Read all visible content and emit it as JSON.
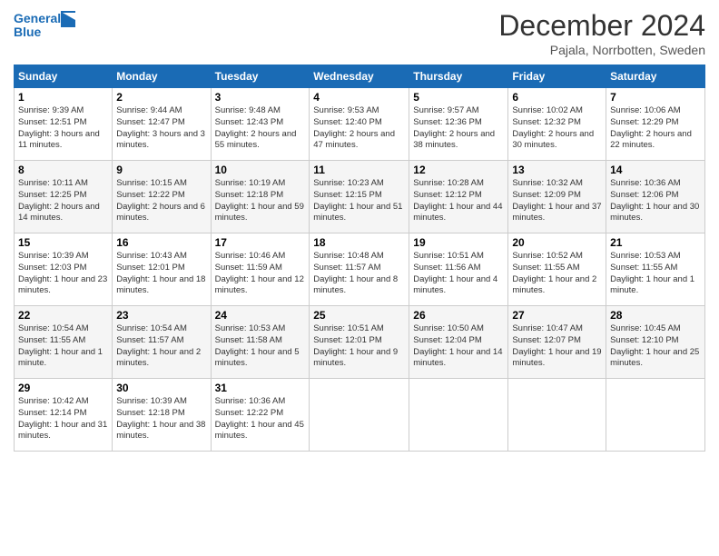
{
  "header": {
    "logo_text_line1": "General",
    "logo_text_line2": "Blue",
    "month_title": "December 2024",
    "location": "Pajala, Norrbotten, Sweden"
  },
  "days_of_week": [
    "Sunday",
    "Monday",
    "Tuesday",
    "Wednesday",
    "Thursday",
    "Friday",
    "Saturday"
  ],
  "weeks": [
    [
      {
        "num": "1",
        "info": "Sunrise: 9:39 AM\nSunset: 12:51 PM\nDaylight: 3 hours and 11 minutes."
      },
      {
        "num": "2",
        "info": "Sunrise: 9:44 AM\nSunset: 12:47 PM\nDaylight: 3 hours and 3 minutes."
      },
      {
        "num": "3",
        "info": "Sunrise: 9:48 AM\nSunset: 12:43 PM\nDaylight: 2 hours and 55 minutes."
      },
      {
        "num": "4",
        "info": "Sunrise: 9:53 AM\nSunset: 12:40 PM\nDaylight: 2 hours and 47 minutes."
      },
      {
        "num": "5",
        "info": "Sunrise: 9:57 AM\nSunset: 12:36 PM\nDaylight: 2 hours and 38 minutes."
      },
      {
        "num": "6",
        "info": "Sunrise: 10:02 AM\nSunset: 12:32 PM\nDaylight: 2 hours and 30 minutes."
      },
      {
        "num": "7",
        "info": "Sunrise: 10:06 AM\nSunset: 12:29 PM\nDaylight: 2 hours and 22 minutes."
      }
    ],
    [
      {
        "num": "8",
        "info": "Sunrise: 10:11 AM\nSunset: 12:25 PM\nDaylight: 2 hours and 14 minutes."
      },
      {
        "num": "9",
        "info": "Sunrise: 10:15 AM\nSunset: 12:22 PM\nDaylight: 2 hours and 6 minutes."
      },
      {
        "num": "10",
        "info": "Sunrise: 10:19 AM\nSunset: 12:18 PM\nDaylight: 1 hour and 59 minutes."
      },
      {
        "num": "11",
        "info": "Sunrise: 10:23 AM\nSunset: 12:15 PM\nDaylight: 1 hour and 51 minutes."
      },
      {
        "num": "12",
        "info": "Sunrise: 10:28 AM\nSunset: 12:12 PM\nDaylight: 1 hour and 44 minutes."
      },
      {
        "num": "13",
        "info": "Sunrise: 10:32 AM\nSunset: 12:09 PM\nDaylight: 1 hour and 37 minutes."
      },
      {
        "num": "14",
        "info": "Sunrise: 10:36 AM\nSunset: 12:06 PM\nDaylight: 1 hour and 30 minutes."
      }
    ],
    [
      {
        "num": "15",
        "info": "Sunrise: 10:39 AM\nSunset: 12:03 PM\nDaylight: 1 hour and 23 minutes."
      },
      {
        "num": "16",
        "info": "Sunrise: 10:43 AM\nSunset: 12:01 PM\nDaylight: 1 hour and 18 minutes."
      },
      {
        "num": "17",
        "info": "Sunrise: 10:46 AM\nSunset: 11:59 AM\nDaylight: 1 hour and 12 minutes."
      },
      {
        "num": "18",
        "info": "Sunrise: 10:48 AM\nSunset: 11:57 AM\nDaylight: 1 hour and 8 minutes."
      },
      {
        "num": "19",
        "info": "Sunrise: 10:51 AM\nSunset: 11:56 AM\nDaylight: 1 hour and 4 minutes."
      },
      {
        "num": "20",
        "info": "Sunrise: 10:52 AM\nSunset: 11:55 AM\nDaylight: 1 hour and 2 minutes."
      },
      {
        "num": "21",
        "info": "Sunrise: 10:53 AM\nSunset: 11:55 AM\nDaylight: 1 hour and 1 minute."
      }
    ],
    [
      {
        "num": "22",
        "info": "Sunrise: 10:54 AM\nSunset: 11:55 AM\nDaylight: 1 hour and 1 minute."
      },
      {
        "num": "23",
        "info": "Sunrise: 10:54 AM\nSunset: 11:57 AM\nDaylight: 1 hour and 2 minutes."
      },
      {
        "num": "24",
        "info": "Sunrise: 10:53 AM\nSunset: 11:58 AM\nDaylight: 1 hour and 5 minutes."
      },
      {
        "num": "25",
        "info": "Sunrise: 10:51 AM\nSunset: 12:01 PM\nDaylight: 1 hour and 9 minutes."
      },
      {
        "num": "26",
        "info": "Sunrise: 10:50 AM\nSunset: 12:04 PM\nDaylight: 1 hour and 14 minutes."
      },
      {
        "num": "27",
        "info": "Sunrise: 10:47 AM\nSunset: 12:07 PM\nDaylight: 1 hour and 19 minutes."
      },
      {
        "num": "28",
        "info": "Sunrise: 10:45 AM\nSunset: 12:10 PM\nDaylight: 1 hour and 25 minutes."
      }
    ],
    [
      {
        "num": "29",
        "info": "Sunrise: 10:42 AM\nSunset: 12:14 PM\nDaylight: 1 hour and 31 minutes."
      },
      {
        "num": "30",
        "info": "Sunrise: 10:39 AM\nSunset: 12:18 PM\nDaylight: 1 hour and 38 minutes."
      },
      {
        "num": "31",
        "info": "Sunrise: 10:36 AM\nSunset: 12:22 PM\nDaylight: 1 hour and 45 minutes."
      },
      null,
      null,
      null,
      null
    ]
  ]
}
